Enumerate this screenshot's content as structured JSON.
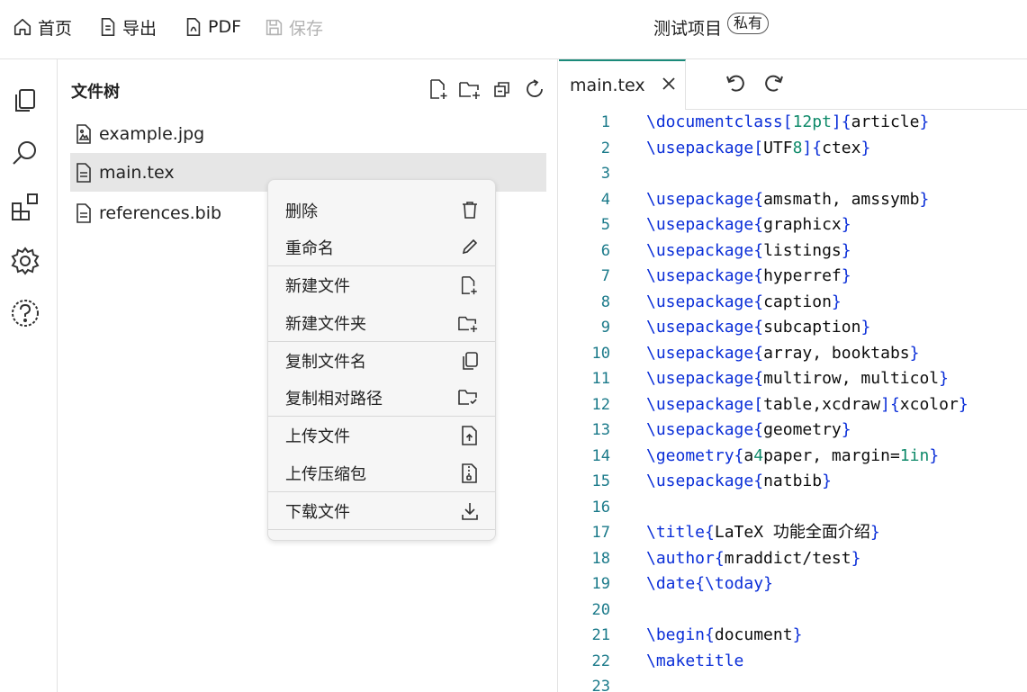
{
  "topbar": {
    "home": "首页",
    "export": "导出",
    "pdf": "PDF",
    "save": "保存",
    "project_title": "测试项目",
    "visibility_badge": "私有"
  },
  "rail": {
    "icons": [
      "files-icon",
      "search-icon",
      "extensions-icon",
      "settings-icon",
      "help-icon"
    ]
  },
  "file_tree": {
    "title": "文件树",
    "tools": [
      "new-file-icon",
      "new-folder-icon",
      "collapse-icon",
      "refresh-icon"
    ],
    "files": [
      {
        "name": "example.jpg",
        "icon": "image-file-icon",
        "selected": false
      },
      {
        "name": "main.tex",
        "icon": "text-file-icon",
        "selected": true
      },
      {
        "name": "references.bib",
        "icon": "text-file-icon",
        "selected": false
      }
    ]
  },
  "context_menu": {
    "items": [
      {
        "label": "删除",
        "icon": "trash-icon"
      },
      {
        "label": "重命名",
        "icon": "pencil-icon"
      },
      {
        "label": "新建文件",
        "icon": "new-file-icon"
      },
      {
        "label": "新建文件夹",
        "icon": "new-folder-icon"
      },
      {
        "label": "复制文件名",
        "icon": "copy-icon"
      },
      {
        "label": "复制相对路径",
        "icon": "folder-check-icon"
      },
      {
        "label": "上传文件",
        "icon": "upload-file-icon"
      },
      {
        "label": "上传压缩包",
        "icon": "zip-file-icon"
      },
      {
        "label": "下载文件",
        "icon": "download-icon"
      }
    ]
  },
  "editor": {
    "tab": "main.tex",
    "lines": [
      {
        "n": "1",
        "text": "\\documentclass[12pt]{article}"
      },
      {
        "n": "2",
        "text": "\\usepackage[UTF8]{ctex}"
      },
      {
        "n": "3",
        "text": ""
      },
      {
        "n": "4",
        "text": "\\usepackage{amsmath, amssymb}"
      },
      {
        "n": "5",
        "text": "\\usepackage{graphicx}"
      },
      {
        "n": "6",
        "text": "\\usepackage{listings}"
      },
      {
        "n": "7",
        "text": "\\usepackage{hyperref}"
      },
      {
        "n": "8",
        "text": "\\usepackage{caption}"
      },
      {
        "n": "9",
        "text": "\\usepackage{subcaption}"
      },
      {
        "n": "10",
        "text": "\\usepackage{array, booktabs}"
      },
      {
        "n": "11",
        "text": "\\usepackage{multirow, multicol}"
      },
      {
        "n": "12",
        "text": "\\usepackage[table,xcdraw]{xcolor}"
      },
      {
        "n": "13",
        "text": "\\usepackage{geometry}"
      },
      {
        "n": "14",
        "text": "\\geometry{a4paper, margin=1in}"
      },
      {
        "n": "15",
        "text": "\\usepackage{natbib}"
      },
      {
        "n": "16",
        "text": ""
      },
      {
        "n": "17",
        "text": "\\title{LaTeX 功能全面介绍}"
      },
      {
        "n": "18",
        "text": "\\author{mraddict/test}"
      },
      {
        "n": "19",
        "text": "\\date{\\today}"
      },
      {
        "n": "20",
        "text": ""
      },
      {
        "n": "21",
        "text": "\\begin{document}"
      },
      {
        "n": "22",
        "text": "\\maketitle"
      },
      {
        "n": "23",
        "text": ""
      }
    ]
  },
  "colors": {
    "accent": "#1a8a7a",
    "keyword": "#0a2ed8",
    "line_number": "#1b7a8a",
    "selected_row": "#e6e6e6"
  }
}
